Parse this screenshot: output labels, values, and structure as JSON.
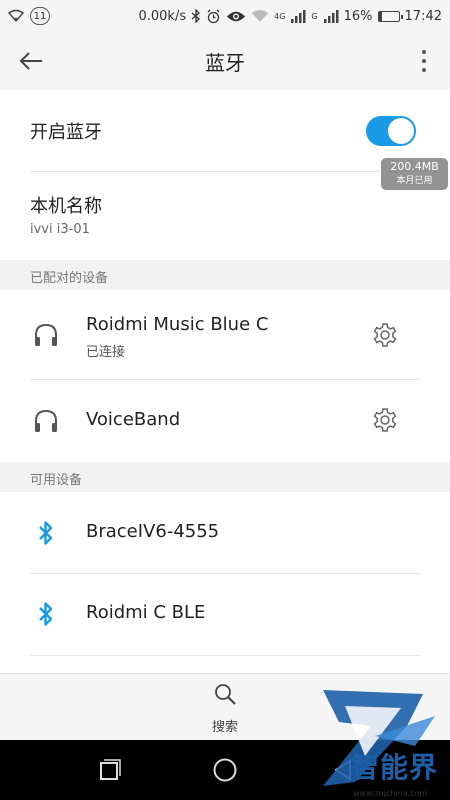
{
  "status_bar": {
    "notification_count": "11",
    "net_speed": "0.00k/s",
    "net_type": "4G",
    "sim2_type": "G",
    "battery": "16%",
    "battery_level": 0.16,
    "time": "17:42"
  },
  "app_bar": {
    "title": "蓝牙",
    "back_icon": "arrow-left-icon",
    "more_icon": "more-vert-icon"
  },
  "bluetooth_toggle": {
    "label": "开启蓝牙",
    "enabled": true,
    "accent": "#1a9be8"
  },
  "data_badge": {
    "amount": "200.4MB",
    "label": "本月已用"
  },
  "device_name": {
    "title": "本机名称",
    "value": "ivvi i3-01"
  },
  "paired_section": {
    "header": "已配对的设备",
    "devices": [
      {
        "name": "Roidmi Music Blue C",
        "status": "已连接",
        "icon": "headphones-icon"
      },
      {
        "name": "VoiceBand",
        "status": "",
        "icon": "headphones-icon"
      }
    ]
  },
  "available_section": {
    "header": "可用设备",
    "devices": [
      {
        "name": "BraceIV6-4555",
        "icon": "bluetooth-icon"
      },
      {
        "name": "Roidmi C BLE",
        "icon": "bluetooth-icon"
      }
    ]
  },
  "bottom_bar": {
    "search_label": "搜索"
  },
  "watermark": {
    "text": "智能界",
    "url": "www.znjchina.com"
  }
}
